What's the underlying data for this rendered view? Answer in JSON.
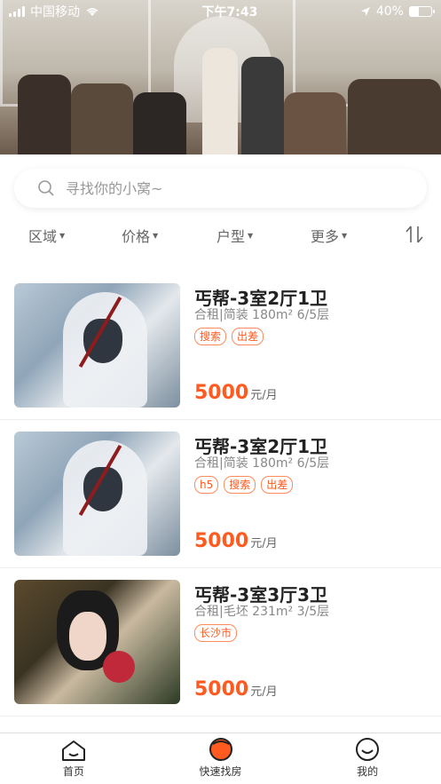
{
  "status_bar": {
    "carrier": "中国移动",
    "time": "下午7:43",
    "battery": "40%",
    "battery_level": 0.4
  },
  "search": {
    "placeholder": "寻找你的小窝~"
  },
  "filters": [
    {
      "label": "区域"
    },
    {
      "label": "价格"
    },
    {
      "label": "户型"
    },
    {
      "label": "更多"
    }
  ],
  "listings": [
    {
      "title": "丐帮-3室2厅1卫",
      "meta": "合租|简装 180m² 6/5层",
      "tags": [
        "搜索",
        "出差"
      ],
      "price": "5000",
      "unit": "元/月",
      "image": "hooded-assassin-artwork"
    },
    {
      "title": "丐帮-3室2厅1卫",
      "meta": "合租|简装 180m² 6/5层",
      "tags": [
        "h5",
        "搜索",
        "出差"
      ],
      "price": "5000",
      "unit": "元/月",
      "image": "hooded-assassin-artwork"
    },
    {
      "title": "丐帮-3室3厅3卫",
      "meta": "合租|毛坯 231m² 3/5层",
      "tags": [
        "长沙市"
      ],
      "price": "5000",
      "unit": "元/月",
      "image": "woman-with-flowers-artwork"
    }
  ],
  "tabbar": {
    "items": [
      {
        "label": "首页",
        "icon": "home-icon"
      },
      {
        "label": "快速找房",
        "icon": "quick-find-icon"
      },
      {
        "label": "我的",
        "icon": "profile-icon"
      }
    ]
  },
  "colors": {
    "accent": "#ff5a1f",
    "text_primary": "#222222",
    "text_secondary": "#888888"
  }
}
